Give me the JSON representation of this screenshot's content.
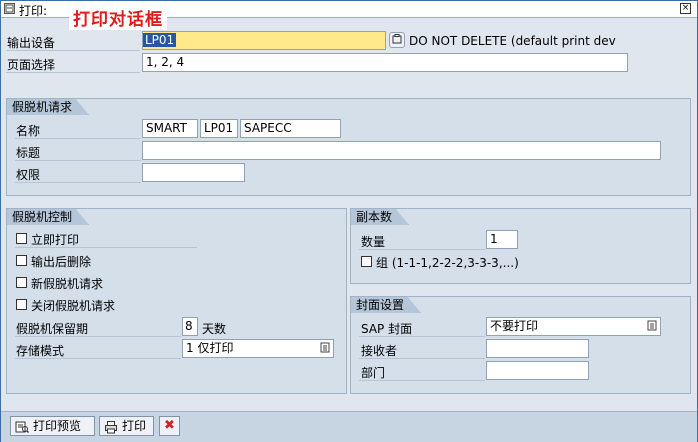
{
  "window": {
    "title": "打印:",
    "banner": "打印对话框",
    "close_symbol": "×"
  },
  "top": {
    "output_device_label": "输出设备",
    "output_device_value": "LP01",
    "output_device_desc": "DO NOT DELETE (default print dev",
    "page_select_label": "页面选择",
    "page_select_value": "1, 2, 4"
  },
  "spool_request": {
    "title": "假脱机请求",
    "name_label": "名称",
    "name_parts": [
      "SMART",
      "LP01",
      "SAPECC"
    ],
    "title_label": "标题",
    "title_value": "",
    "auth_label": "权限",
    "auth_value": ""
  },
  "spool_control": {
    "title": "假脱机控制",
    "print_immediately": "立即打印",
    "delete_after_output": "输出后删除",
    "new_spool_request": "新假脱机请求",
    "close_spool_request": "关闭假脱机请求",
    "retention_label": "假脱机保留期",
    "retention_value": "8",
    "retention_unit": "天数",
    "storage_mode_label": "存储模式",
    "storage_mode_value": "1 仅打印"
  },
  "copies": {
    "title": "副本数",
    "quantity_label": "数量",
    "quantity_value": "1",
    "group_label": "组 (1-1-1,2-2-2,3-3-3,...)"
  },
  "cover": {
    "title": "封面设置",
    "sap_cover_label": "SAP 封面",
    "sap_cover_value": "不要打印",
    "recipient_label": "接收者",
    "recipient_value": "",
    "department_label": "部门",
    "department_value": ""
  },
  "footer": {
    "preview_label": "打印预览",
    "print_label": "打印",
    "cancel_symbol": "✖"
  },
  "colors": {
    "banner": "#e21a1a",
    "cancel": "#d42020",
    "required_field": "#ffe98a"
  }
}
